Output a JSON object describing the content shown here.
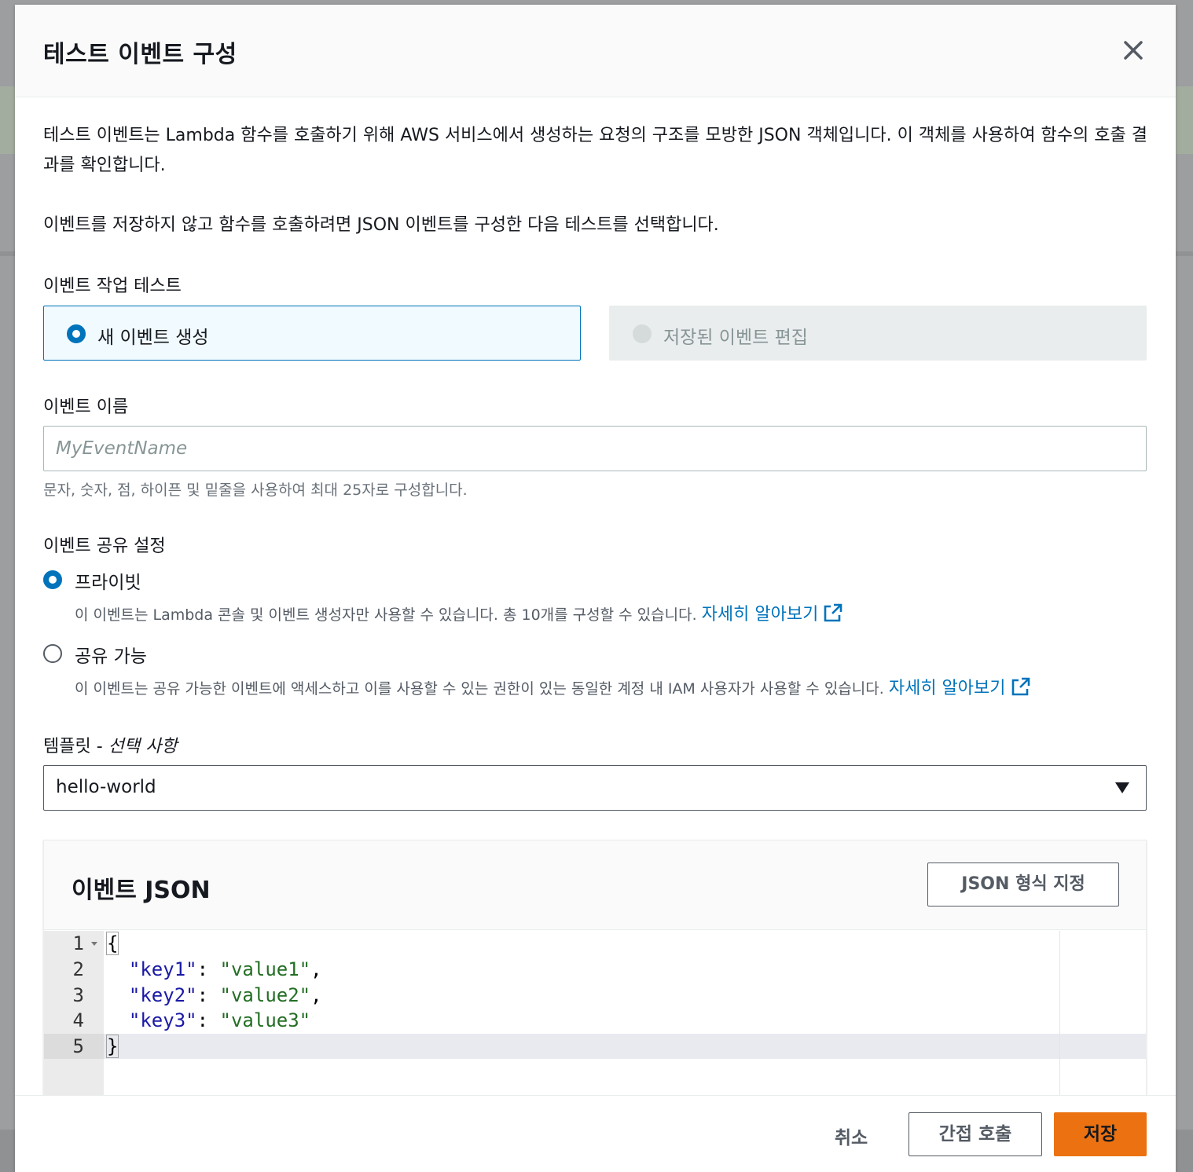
{
  "modal": {
    "title": "테스트 이벤트 구성",
    "close_icon": "close-icon",
    "description_1": "테스트 이벤트는 Lambda 함수를 호출하기 위해 AWS 서비스에서 생성하는 요청의 구조를 모방한 JSON 객체입니다. 이 객체를 사용하여 함수의 호출 결과를 확인합니다.",
    "description_2": "이벤트를 저장하지 않고 함수를 호출하려면 JSON 이벤트를 구성한 다음 테스트를 선택합니다."
  },
  "event_action": {
    "label": "이벤트 작업 테스트",
    "options": [
      {
        "label": "새 이벤트 생성",
        "selected": true,
        "disabled": false
      },
      {
        "label": "저장된 이벤트 편집",
        "selected": false,
        "disabled": true
      }
    ]
  },
  "event_name": {
    "label": "이벤트 이름",
    "placeholder": "MyEventName",
    "value": "",
    "hint": "문자, 숫자, 점, 하이픈 및 밑줄을 사용하여 최대 25자로 구성합니다."
  },
  "sharing": {
    "label": "이벤트 공유 설정",
    "options": [
      {
        "label": "프라이빗",
        "selected": true,
        "description": "이 이벤트는 Lambda 콘솔 및 이벤트 생성자만 사용할 수 있습니다. 총 10개를 구성할 수 있습니다.",
        "link": "자세히 알아보기",
        "link_icon": "external-link-icon"
      },
      {
        "label": "공유 가능",
        "selected": false,
        "description": "이 이벤트는 공유 가능한 이벤트에 액세스하고 이를 사용할 수 있는 권한이 있는 동일한 계정 내 IAM 사용자가 사용할 수 있습니다.",
        "link": "자세히 알아보기",
        "link_icon": "external-link-icon"
      }
    ]
  },
  "template": {
    "label": "템플릿 -",
    "optional": "선택 사항",
    "selected": "hello-world",
    "caret_icon": "caret-down-icon"
  },
  "event_json": {
    "title": "이벤트 JSON",
    "format_button": "JSON 형식 지정",
    "line_numbers": [
      "1",
      "2",
      "3",
      "4",
      "5"
    ],
    "open_brace": "{",
    "close_brace": "}",
    "entries": [
      {
        "key": "\"key1\"",
        "value": "\"value1\"",
        "trail": ","
      },
      {
        "key": "\"key2\"",
        "value": "\"value2\"",
        "trail": ","
      },
      {
        "key": "\"key3\"",
        "value": "\"value3\"",
        "trail": ""
      }
    ]
  },
  "footer": {
    "cancel": "취소",
    "invoke": "간접 호출",
    "save": "저장"
  },
  "colors": {
    "primary": "#0073bb",
    "save_button": "#ec7211",
    "json_key": "#1a1aa6",
    "json_string": "#236e24"
  }
}
